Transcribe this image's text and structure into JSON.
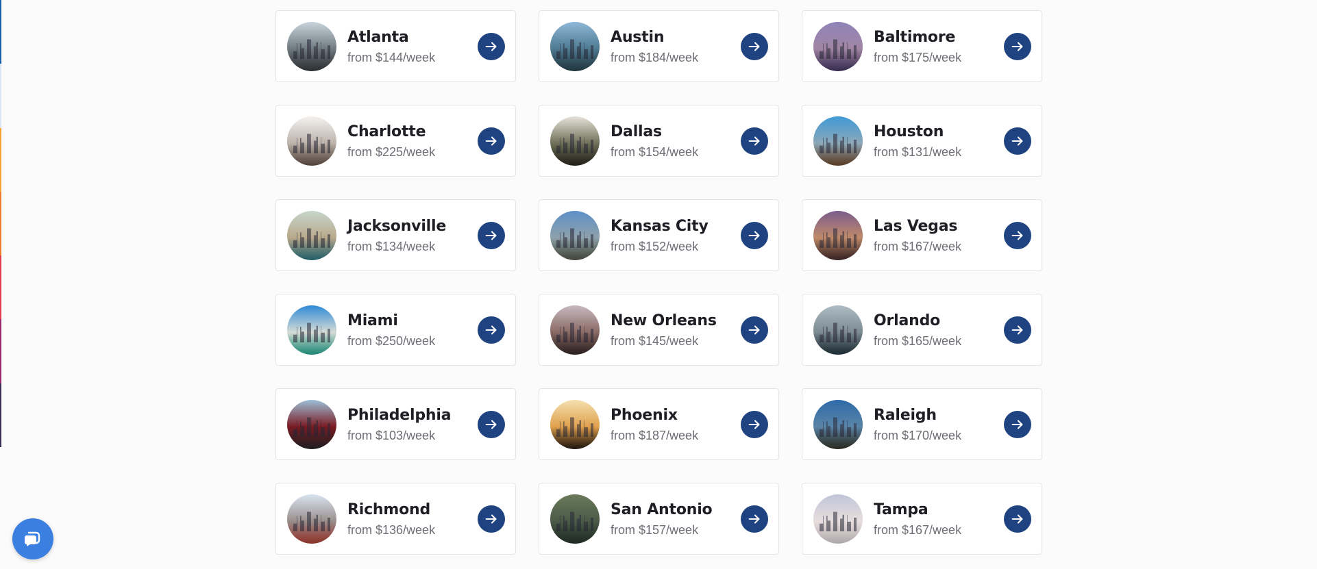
{
  "side_stripe": {
    "colors": [
      "#1d5fa8",
      "#dce8f6",
      "#f3a02c",
      "#f07a2a",
      "#e8394f",
      "#9b2b6f",
      "#3b2f55"
    ]
  },
  "icons": {
    "arrow": "arrow-right-icon",
    "chat": "chat-bubble-icon"
  },
  "accent_color": "#1f4380",
  "chat_color": "#3b7fe0",
  "cities": [
    {
      "name": "Atlanta",
      "price": "from $144/week",
      "thumb": [
        "#c9d4dc",
        "#6f7a80",
        "#3e4145"
      ]
    },
    {
      "name": "Austin",
      "price": "from $184/week",
      "thumb": [
        "#8fb8d8",
        "#4e7a92",
        "#2c4a54"
      ]
    },
    {
      "name": "Baltimore",
      "price": "from $175/week",
      "thumb": [
        "#8f84b8",
        "#a285a4",
        "#4a3c6a"
      ]
    },
    {
      "name": "Charlotte",
      "price": "from $225/week",
      "thumb": [
        "#f4f2f0",
        "#bcb2aa",
        "#6e5a4e"
      ]
    },
    {
      "name": "Dallas",
      "price": "from $154/week",
      "thumb": [
        "#e6e2da",
        "#6f7058",
        "#2e2a22"
      ]
    },
    {
      "name": "Houston",
      "price": "from $131/week",
      "thumb": [
        "#3f9ad6",
        "#8da8b8",
        "#7a5030"
      ]
    },
    {
      "name": "Jacksonville",
      "price": "from $134/week",
      "thumb": [
        "#c7d6cc",
        "#b9a98a",
        "#2f7f8e"
      ]
    },
    {
      "name": "Kansas City",
      "price": "from $152/week",
      "thumb": [
        "#5e8fc8",
        "#8ea2aa",
        "#5a5e50"
      ]
    },
    {
      "name": "Las Vegas",
      "price": "from $167/week",
      "thumb": [
        "#7b5c8c",
        "#c08a6a",
        "#4a2e30"
      ]
    },
    {
      "name": "Miami",
      "price": "from $250/week",
      "thumb": [
        "#2f8ad6",
        "#d6dcd6",
        "#2cb8a0"
      ]
    },
    {
      "name": "New Orleans",
      "price": "from $145/week",
      "thumb": [
        "#c8b8c0",
        "#8a6a64",
        "#3a2a2c"
      ]
    },
    {
      "name": "Orlando",
      "price": "from $165/week",
      "thumb": [
        "#aebcc4",
        "#7c8a92",
        "#263a44"
      ]
    },
    {
      "name": "Philadelphia",
      "price": "from $103/week",
      "thumb": [
        "#9cc0d8",
        "#7a1a22",
        "#2a2a2e"
      ]
    },
    {
      "name": "Phoenix",
      "price": "from $187/week",
      "thumb": [
        "#f4e0b0",
        "#e0a04c",
        "#2a1e14"
      ]
    },
    {
      "name": "Raleigh",
      "price": "from $170/week",
      "thumb": [
        "#2e6aa8",
        "#5a84a8",
        "#3a3a2c"
      ]
    },
    {
      "name": "Richmond",
      "price": "from $136/week",
      "thumb": [
        "#d8e4f0",
        "#9a8e8c",
        "#c0463a"
      ]
    },
    {
      "name": "San Antonio",
      "price": "from $157/week",
      "thumb": [
        "#6a7a5a",
        "#4a5a48",
        "#2a3a30"
      ]
    },
    {
      "name": "Tampa",
      "price": "from $167/week",
      "thumb": [
        "#c0c4d8",
        "#e8dede",
        "#f0e8ea"
      ]
    }
  ]
}
